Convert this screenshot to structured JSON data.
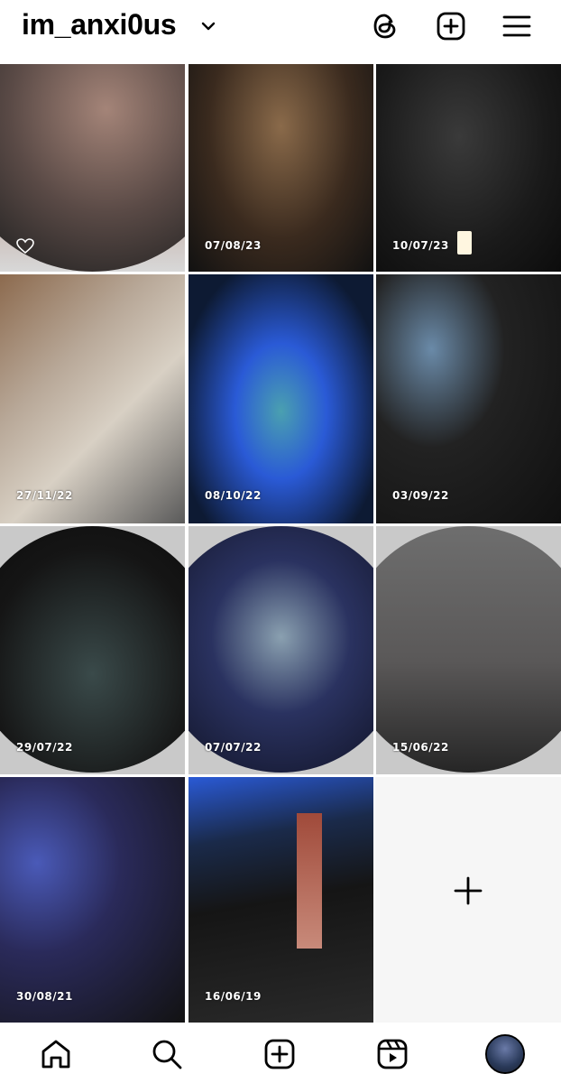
{
  "header": {
    "username": "im_anxi0us",
    "icons": [
      "chevron-down-icon",
      "threads-icon",
      "new-post-icon",
      "menu-icon"
    ]
  },
  "grid": {
    "posts": [
      {
        "date": "",
        "liked_icon": "heart-icon"
      },
      {
        "date": "07/08/23"
      },
      {
        "date": "10/07/23"
      },
      {
        "date": "27/11/22"
      },
      {
        "date": "08/10/22"
      },
      {
        "date": "03/09/22"
      },
      {
        "date": "29/07/22"
      },
      {
        "date": "07/07/22"
      },
      {
        "date": "15/06/22"
      },
      {
        "date": "30/08/21"
      },
      {
        "date": "16/06/19"
      }
    ],
    "add_tile_icon": "plus-icon"
  },
  "nav": {
    "items": [
      "home-icon",
      "search-icon",
      "create-icon",
      "reels-icon",
      "profile-avatar"
    ]
  },
  "colors": {
    "background": "#ffffff",
    "icon": "#000000",
    "date_text": "#ffffff",
    "stage_blue": "#2a5ad6"
  }
}
